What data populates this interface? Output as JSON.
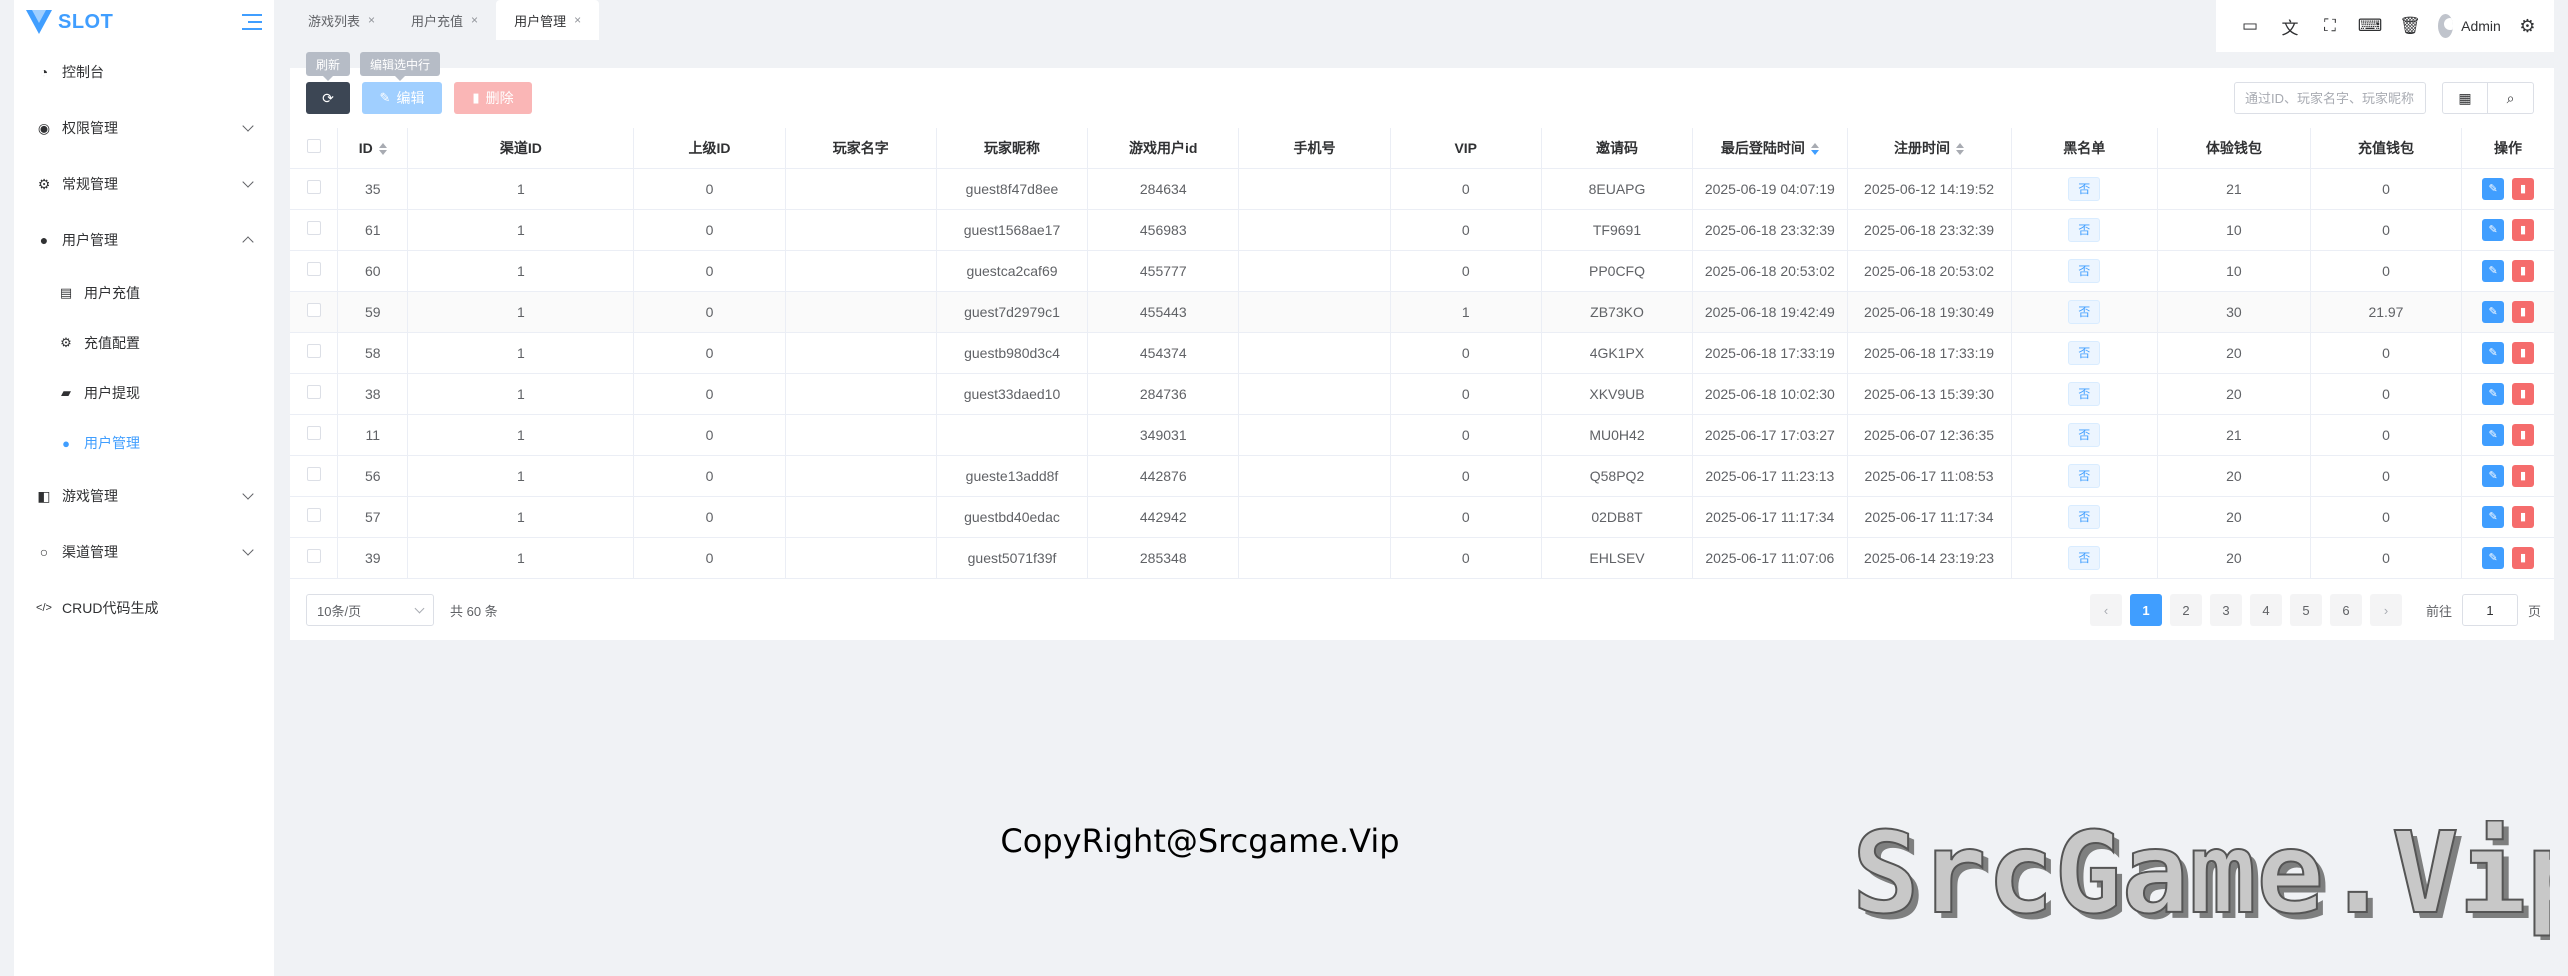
{
  "brand": {
    "title": "SLOT"
  },
  "sidebar": {
    "items": [
      {
        "label": "控制台",
        "icon": "dashboard-icon",
        "glyph": "◔"
      },
      {
        "label": "权限管理",
        "icon": "users-group-icon",
        "glyph": "◉",
        "arrow": "down"
      },
      {
        "label": "常规管理",
        "icon": "cogs-icon",
        "glyph": "⚙",
        "arrow": "down"
      },
      {
        "label": "用户管理",
        "icon": "user-icon",
        "glyph": "●",
        "arrow": "up",
        "children": [
          {
            "label": "用户充值",
            "icon": "clipboard-icon",
            "glyph": "▤"
          },
          {
            "label": "充值配置",
            "icon": "gear-icon",
            "glyph": "⚙"
          },
          {
            "label": "用户提现",
            "icon": "wallet-icon",
            "glyph": "▰"
          },
          {
            "label": "用户管理",
            "icon": "user-icon",
            "glyph": "●",
            "active": true
          }
        ]
      },
      {
        "label": "游戏管理",
        "icon": "gamepad-icon",
        "glyph": "◧",
        "arrow": "down"
      },
      {
        "label": "渠道管理",
        "icon": "circle-icon",
        "glyph": "○",
        "arrow": "down"
      },
      {
        "label": "CRUD代码生成",
        "icon": "code-icon",
        "glyph": "</>"
      }
    ]
  },
  "tabs": [
    {
      "label": "游戏列表",
      "close": "×"
    },
    {
      "label": "用户充值",
      "close": "×"
    },
    {
      "label": "用户管理",
      "close": "×",
      "active": true
    }
  ],
  "toolbar": {
    "icons": [
      {
        "name": "monitor-icon",
        "glyph": "▭"
      },
      {
        "name": "translate-icon",
        "glyph": "文"
      },
      {
        "name": "fullscreen-icon",
        "glyph": "⛶"
      },
      {
        "name": "terminal-icon",
        "glyph": "⌨"
      },
      {
        "name": "trash-icon",
        "glyph": "🗑"
      }
    ],
    "user": "Admin",
    "settings_glyph": "⚙"
  },
  "actions": {
    "refresh_tip": "刷新",
    "edit_tip": "编辑选中行",
    "edit_label": "编辑",
    "delete_label": "删除"
  },
  "search": {
    "placeholder": "通过ID、玩家名字、玩家昵称"
  },
  "table": {
    "columns": [
      "",
      "ID",
      "渠道ID",
      "上级ID",
      "玩家名字",
      "玩家昵称",
      "游戏用户id",
      "手机号",
      "VIP",
      "邀请码",
      "最后登陆时间",
      "注册时间",
      "黑名单",
      "体验钱包",
      "充值钱包",
      "操作"
    ],
    "sortable": [
      "ID",
      "最后登陆时间",
      "注册时间"
    ],
    "blacklist_label": "否",
    "rows": [
      [
        "35",
        "1",
        "0",
        "",
        "guest8f47d8ee",
        "284634",
        "",
        "0",
        "8EUAPG",
        "2025-06-19 04:07:19",
        "2025-06-12 14:19:52",
        "21",
        "0"
      ],
      [
        "61",
        "1",
        "0",
        "",
        "guest1568ae17",
        "456983",
        "",
        "0",
        "TF9691",
        "2025-06-18 23:32:39",
        "2025-06-18 23:32:39",
        "10",
        "0"
      ],
      [
        "60",
        "1",
        "0",
        "",
        "guestca2caf69",
        "455777",
        "",
        "0",
        "PP0CFQ",
        "2025-06-18 20:53:02",
        "2025-06-18 20:53:02",
        "10",
        "0"
      ],
      [
        "59",
        "1",
        "0",
        "",
        "guest7d2979c1",
        "455443",
        "",
        "1",
        "ZB73KO",
        "2025-06-18 19:42:49",
        "2025-06-18 19:30:49",
        "30",
        "21.97"
      ],
      [
        "58",
        "1",
        "0",
        "",
        "guestb980d3c4",
        "454374",
        "",
        "0",
        "4GK1PX",
        "2025-06-18 17:33:19",
        "2025-06-18 17:33:19",
        "20",
        "0"
      ],
      [
        "38",
        "1",
        "0",
        "",
        "guest33daed10",
        "284736",
        "",
        "0",
        "XKV9UB",
        "2025-06-18 10:02:30",
        "2025-06-13 15:39:30",
        "20",
        "0"
      ],
      [
        "11",
        "1",
        "0",
        "",
        "",
        "349031",
        "",
        "0",
        "MU0H42",
        "2025-06-17 17:03:27",
        "2025-06-07 12:36:35",
        "21",
        "0"
      ],
      [
        "56",
        "1",
        "0",
        "",
        "gueste13add8f",
        "442876",
        "",
        "0",
        "Q58PQ2",
        "2025-06-17 11:23:13",
        "2025-06-17 11:08:53",
        "20",
        "0"
      ],
      [
        "57",
        "1",
        "0",
        "",
        "guestbd40edac",
        "442942",
        "",
        "0",
        "02DB8T",
        "2025-06-17 11:17:34",
        "2025-06-17 11:17:34",
        "20",
        "0"
      ],
      [
        "39",
        "1",
        "0",
        "",
        "guest5071f39f",
        "285348",
        "",
        "0",
        "EHLSEV",
        "2025-06-17 11:07:06",
        "2025-06-14 23:19:23",
        "20",
        "0"
      ]
    ]
  },
  "pagination": {
    "page_size": "10条/页",
    "total": "共 60 条",
    "pages": [
      "1",
      "2",
      "3",
      "4",
      "5",
      "6"
    ],
    "current": "1",
    "prev": "‹",
    "next": "›",
    "goto_label": "前往",
    "goto_value": "1",
    "goto_unit": "页"
  },
  "footer": {
    "copyright": "CopyRight@Srcgame.Vip"
  },
  "watermark": {
    "text": "SrcGame.Vip"
  },
  "colors": {
    "primary": "#409eff",
    "danger": "#f56c6c",
    "dark": "#3c4654"
  }
}
